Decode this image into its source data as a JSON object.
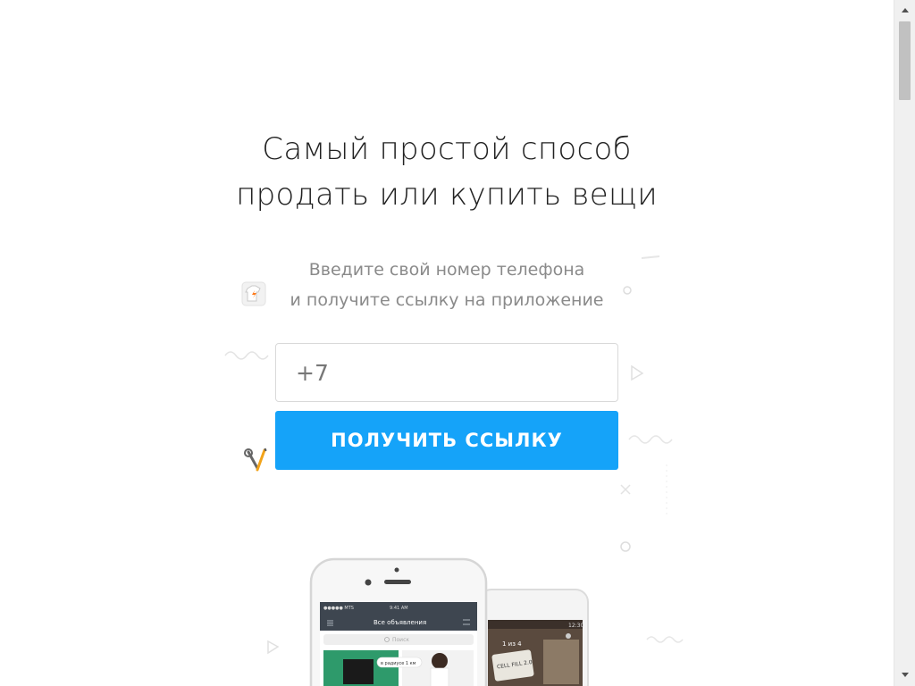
{
  "hero": {
    "headline_line1": "Самый простой способ",
    "headline_line2": "продать или купить вещи",
    "subtitle_line1": "Введите свой номер телефона",
    "subtitle_line2": "и получите ссылку на приложение"
  },
  "form": {
    "phone_value": "+7",
    "submit_label": "ПОЛУЧИТЬ ССЫЛКУ"
  },
  "mockups": {
    "back_phone": {
      "status_carrier": "●●●●● MTS",
      "status_time": "9:41 AM",
      "title": "Все объявления",
      "search_placeholder": "Поиск",
      "chip": "в радиусе 1 км"
    },
    "front_phone": {
      "status_time": "12:30",
      "counter": "1 из 4",
      "card_text": "CELL FILL 2.0"
    }
  },
  "icons": {
    "shirt": "tshirt-sticker-icon",
    "tools": "wrench-screwdriver-icon"
  },
  "colors": {
    "accent": "#15a3f9",
    "headline": "#222222",
    "subtitle": "#8a8a8a"
  }
}
